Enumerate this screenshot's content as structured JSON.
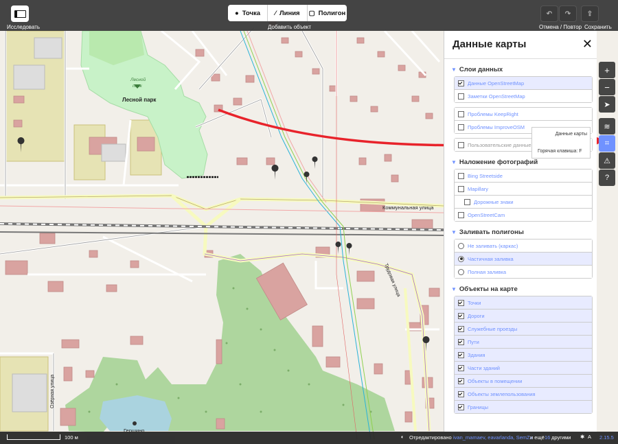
{
  "toolbar": {
    "explore_label": "Исследовать",
    "add_label": "Добавить объект",
    "point_label": "Точка",
    "line_label": "Линия",
    "polygon_label": "Полигон",
    "undo_redo_label": "Отмена / Повтор",
    "save_label": "Сохранить"
  },
  "map_labels": {
    "park_name": "Лесной парк",
    "park_name_italic": "Лесной\nпарк",
    "street_kommunalnaya": "Коммунальная улица",
    "street_ozernaya": "Озёрная улица",
    "street_trudovaya": "Трудовая улица",
    "village": "Гершино"
  },
  "panel": {
    "title": "Данные карты",
    "sections": [
      {
        "title": "Слои данных",
        "rows": [
          {
            "label": "Данные OpenStreetMap",
            "checked": true,
            "active": true
          },
          {
            "label": "Заметки OpenStreetMap",
            "checked": false,
            "active": false
          }
        ],
        "rows2": [
          {
            "label": "Проблемы KeepRight",
            "checked": false
          },
          {
            "label": "Проблемы ImproveOSM",
            "checked": false
          }
        ],
        "rows3": [
          {
            "label": "Пользовательские данные карты",
            "checked": false
          }
        ]
      },
      {
        "title": "Наложение фотографий",
        "rows": [
          {
            "label": "Bing Streetside",
            "checked": false
          },
          {
            "label": "Mapillary",
            "checked": false
          },
          {
            "label": "Дорожные знаки",
            "checked": false,
            "indent": true
          },
          {
            "label": "OpenStreetCam",
            "checked": false
          }
        ]
      },
      {
        "title": "Заливать полигоны",
        "rows": [
          {
            "label": "Не заливать (каркас)",
            "selected": false
          },
          {
            "label": "Частичная заливка",
            "selected": true
          },
          {
            "label": "Полная заливка",
            "selected": false
          }
        ]
      },
      {
        "title": "Объекты на карте",
        "rows": [
          {
            "label": "Точки",
            "checked": true
          },
          {
            "label": "Дороги",
            "checked": true
          },
          {
            "label": "Служебные проезды",
            "checked": true
          },
          {
            "label": "Пути",
            "checked": true
          },
          {
            "label": "Здания",
            "checked": true
          },
          {
            "label": "Части зданий",
            "checked": true
          },
          {
            "label": "Объекты в помещении",
            "checked": true
          },
          {
            "label": "Объекты землепользования",
            "checked": true
          },
          {
            "label": "Границы",
            "checked": true
          }
        ]
      }
    ]
  },
  "tooltip": {
    "title": "Данные карты",
    "hotkey": "Горячая клавиша: F"
  },
  "footer": {
    "scale": "100 м",
    "edited_prefix": "Отредактировано",
    "editors": "ivan_mamaev, eavarlanda, SemZx",
    "and_more": "и ещё",
    "others": "другими",
    "others_count": "16",
    "version": "2.15.5"
  },
  "colors": {
    "accent": "#7092ff",
    "toolbar_bg": "#373737",
    "arrow": "#e8232b",
    "forest": "#add19e",
    "park": "#c8facc",
    "water": "#aad3df",
    "building": "#d9a3a0",
    "residential": "#e0dfa9"
  }
}
